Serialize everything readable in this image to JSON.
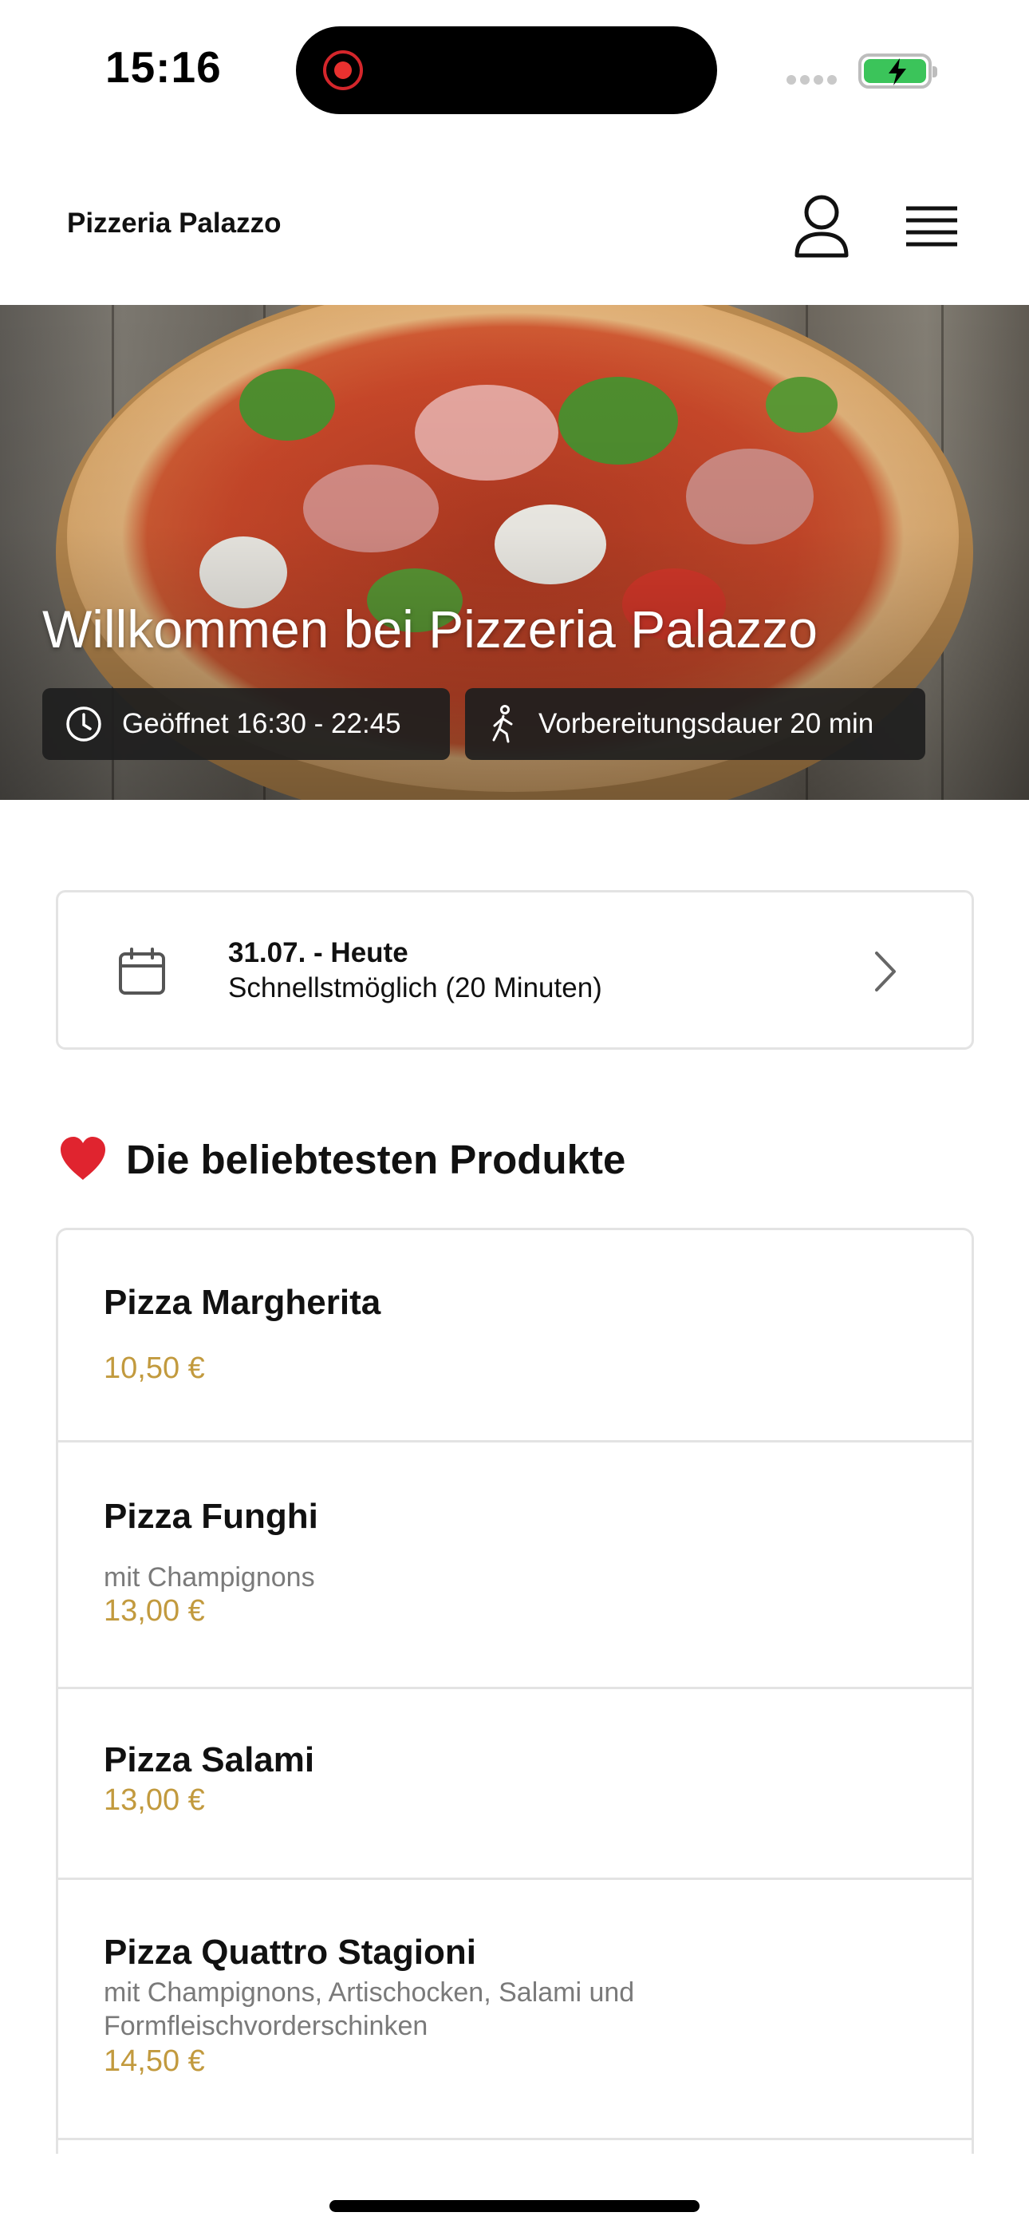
{
  "status_bar": {
    "time": "15:16"
  },
  "header": {
    "brand": "Pizzeria Palazzo",
    "icons": [
      "user-icon",
      "menu-icon"
    ]
  },
  "hero": {
    "title": "Willkommen bei Pizzeria Palazzo",
    "opening_hours": "Geöffnet 16:30 - 22:45",
    "prep_time": "Vorbereitungsdauer 20 min"
  },
  "pickup": {
    "date": "31.07. - Heute",
    "time": "Schnellstmöglich (20 Minuten)"
  },
  "popular": {
    "title": "Die beliebtesten Produkte",
    "items": [
      {
        "name": "Pizza Margherita",
        "description": "",
        "price": "10,50 €"
      },
      {
        "name": "Pizza Funghi",
        "description": "mit Champignons",
        "price": "13,00 €"
      },
      {
        "name": "Pizza Salami",
        "description": "",
        "price": "13,00 €"
      },
      {
        "name": "Pizza Quattro Stagioni",
        "description": "mit Champignons, Artischocken, Salami und Formfleischvorderschinken",
        "price": "14,50 €"
      }
    ]
  },
  "colors": {
    "price": "#c29a3e",
    "chip_bg": "#1e1e1e",
    "border": "#e3e3e3",
    "heart": "#e0242f",
    "battery": "#3bc45a"
  }
}
